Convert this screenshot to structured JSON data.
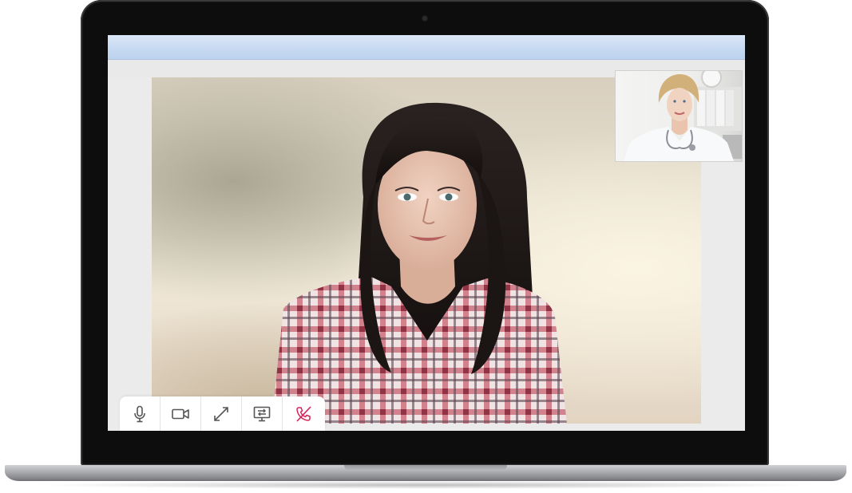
{
  "call": {
    "remote_participant": "patient-video",
    "self_participant": "doctor-self-view"
  },
  "controls": [
    {
      "id": "microphone",
      "icon": "microphone-icon",
      "color": "#555555"
    },
    {
      "id": "camera",
      "icon": "video-camera-icon",
      "color": "#555555"
    },
    {
      "id": "fullscreen",
      "icon": "expand-icon",
      "color": "#555555"
    },
    {
      "id": "share-screen",
      "icon": "screen-share-icon",
      "color": "#555555"
    },
    {
      "id": "end-call",
      "icon": "hang-up-phone-icon",
      "color": "#d6245a"
    }
  ],
  "colors": {
    "bezel": "#0d0d0d",
    "browser_bar": "#c8daf2",
    "end_call": "#d6245a"
  }
}
